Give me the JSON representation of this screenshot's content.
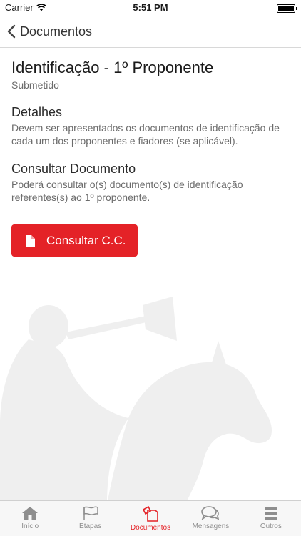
{
  "status_bar": {
    "carrier": "Carrier",
    "time": "5:51 PM",
    "battery_level": 1.0
  },
  "nav": {
    "back_label": "Documentos"
  },
  "main": {
    "title": "Identificação - 1º Proponente",
    "subtitle": "Submetido",
    "sections": [
      {
        "heading": "Detalhes",
        "body": "Devem ser apresentados os documentos de identificação de cada um dos proponentes e fiadores (se aplicável)."
      },
      {
        "heading": "Consultar Documento",
        "body": "Poderá consultar o(s) documento(s) de identificação referentes(s) ao 1º proponente."
      }
    ],
    "action_button": {
      "label": "Consultar C.C.",
      "icon": "document-icon"
    }
  },
  "tabs": [
    {
      "label": "Início",
      "icon": "home-icon",
      "active": false
    },
    {
      "label": "Etapas",
      "icon": "flag-icon",
      "active": false
    },
    {
      "label": "Documentos",
      "icon": "documents-icon",
      "active": true
    },
    {
      "label": "Mensagens",
      "icon": "chat-bubbles-icon",
      "active": false
    },
    {
      "label": "Outros",
      "icon": "menu-icon",
      "active": false
    }
  ],
  "colors": {
    "accent": "#e42227",
    "inactive": "#8e8e8e",
    "watermark": "#efefef"
  }
}
